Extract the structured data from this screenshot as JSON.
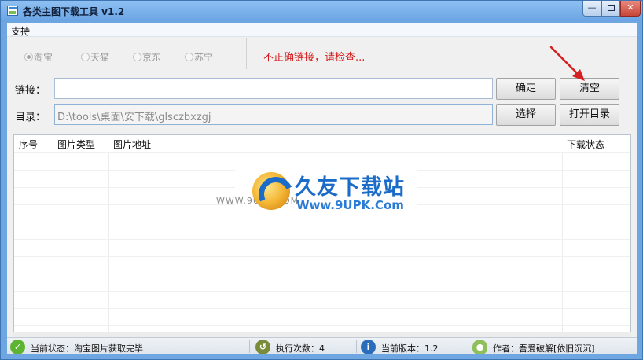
{
  "window": {
    "title": "各类主图下载工具 v1.2",
    "controls": {
      "minimize": "—",
      "close": "✕"
    }
  },
  "menu": {
    "items": [
      "支持"
    ]
  },
  "platforms": {
    "options": [
      "淘宝",
      "天猫",
      "京东",
      "苏宁"
    ],
    "selected": "淘宝"
  },
  "error_message": "不正确链接，请检查...",
  "link_field": {
    "label": "链接：",
    "value": ""
  },
  "dir_field": {
    "label": "目录：",
    "value": "D:\\tools\\桌面\\安下载\\glsczbxzgj"
  },
  "buttons": {
    "confirm": "确定",
    "clear": "清空",
    "choose": "选择",
    "open_dir": "打开目录"
  },
  "table": {
    "columns": [
      "序号",
      "图片类型",
      "图片地址",
      "下载状态"
    ],
    "rows": []
  },
  "watermark": {
    "www": "WWW.9UPK.COM",
    "cn": "久友下载站",
    "url": "Www.9UPK.Com"
  },
  "statusbar": {
    "status": "当前状态：淘宝图片获取完毕",
    "runs": "执行次数：4",
    "version": "当前版本：1.2",
    "author": "作者：吾爱破解[依旧沉沉]"
  },
  "colors": {
    "error": "#d41a1a",
    "annotation_arrow": "#d42020",
    "title_bar": "#7db4ec"
  },
  "icons": {
    "status": "check-circle-icon",
    "runs": "history-clock-icon",
    "version": "info-icon",
    "author": "user-icon"
  }
}
